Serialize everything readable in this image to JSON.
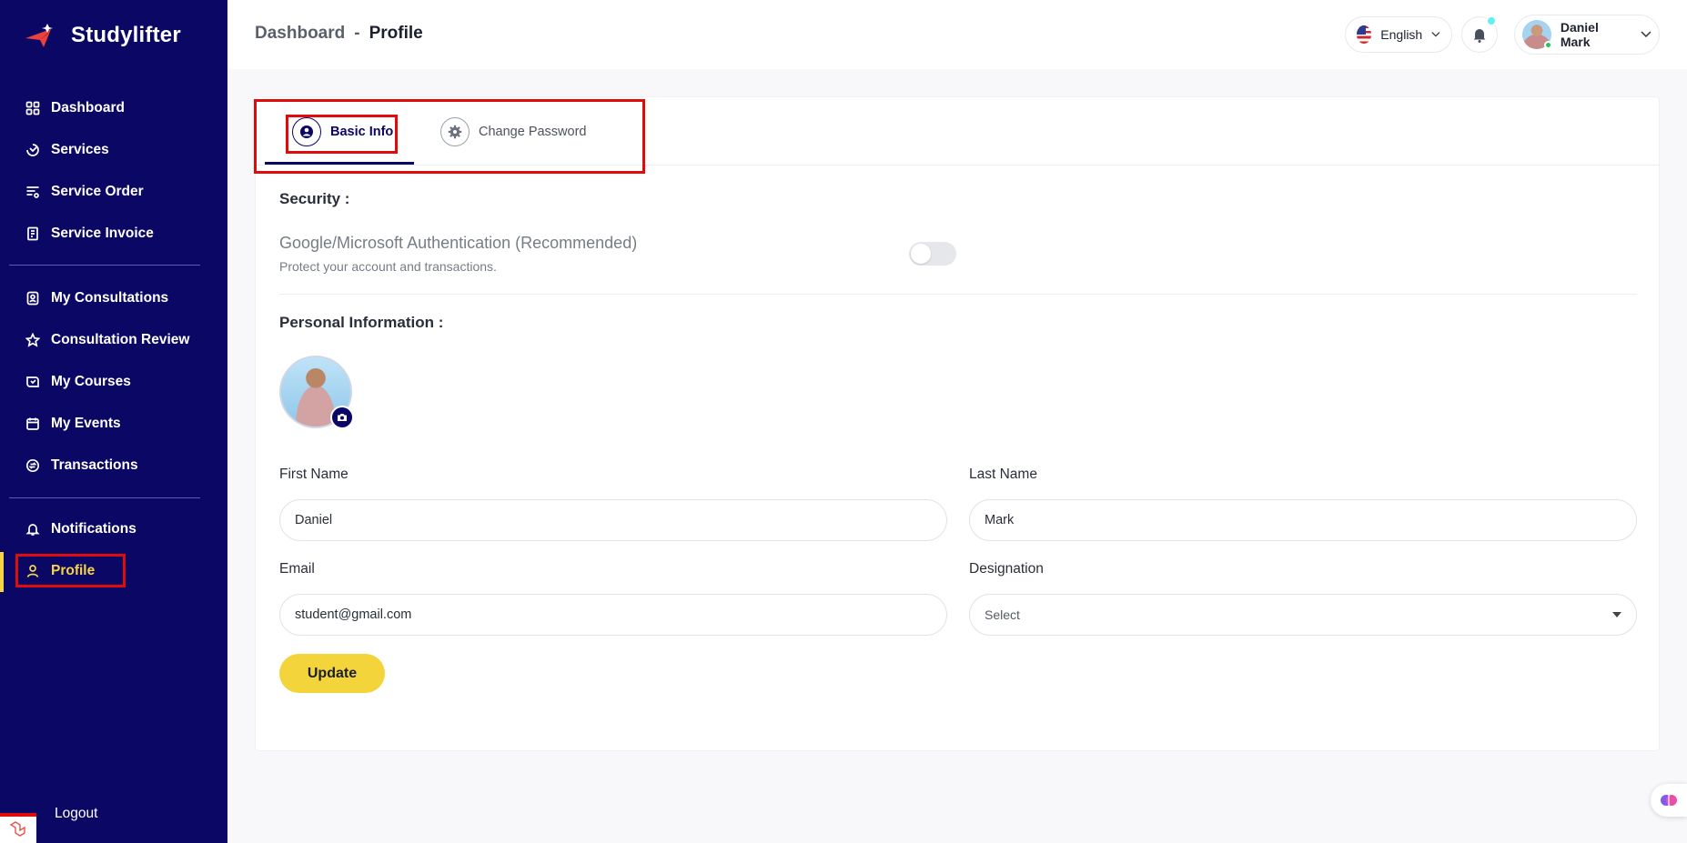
{
  "brand": {
    "name": "Studylifter"
  },
  "sidebar": {
    "items": [
      {
        "label": "Dashboard",
        "icon": "grid-icon"
      },
      {
        "label": "Services",
        "icon": "services-icon"
      },
      {
        "label": "Service Order",
        "icon": "list-filter-icon"
      },
      {
        "label": "Service Invoice",
        "icon": "invoice-icon"
      },
      {
        "label": "My Consultations",
        "icon": "consultation-icon"
      },
      {
        "label": "Consultation Review",
        "icon": "star-icon"
      },
      {
        "label": "My Courses",
        "icon": "courses-icon"
      },
      {
        "label": "My Events",
        "icon": "calendar-icon"
      },
      {
        "label": "Transactions",
        "icon": "transactions-icon"
      },
      {
        "label": "Notifications",
        "icon": "bell-icon"
      },
      {
        "label": "Profile",
        "icon": "user-icon"
      }
    ],
    "active": "Profile",
    "logout_label": "Logout"
  },
  "header": {
    "breadcrumb_root": "Dashboard",
    "breadcrumb_sep": "-",
    "breadcrumb_current": "Profile",
    "language": "English",
    "user_name": "Daniel Mark"
  },
  "tabs": [
    {
      "label": "Basic Info",
      "icon": "user-circle-icon",
      "active": true
    },
    {
      "label": "Change Password",
      "icon": "gear-icon",
      "active": false
    }
  ],
  "security": {
    "title": "Security :",
    "auth_title": "Google/Microsoft Authentication (Recommended)",
    "auth_subtitle": "Protect your account and transactions.",
    "enabled": false
  },
  "personal": {
    "title": "Personal Information :",
    "first_name_label": "First Name",
    "first_name": "Daniel",
    "last_name_label": "Last Name",
    "last_name": "Mark",
    "email_label": "Email",
    "email": "student@gmail.com",
    "designation_label": "Designation",
    "designation": "Select",
    "update_label": "Update"
  },
  "colors": {
    "sidebar": "#0b0764",
    "accent": "#f3d43a",
    "highlight": "#e10b0b"
  }
}
